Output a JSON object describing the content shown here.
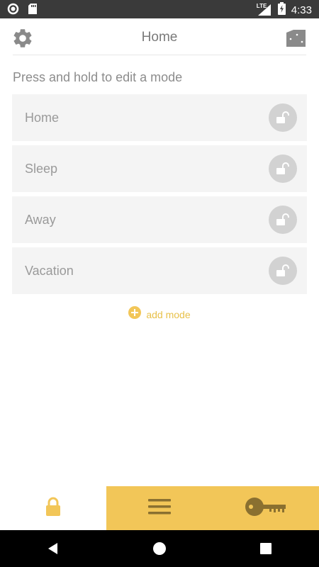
{
  "status_bar": {
    "time": "4:33",
    "network": "LTE",
    "icons": [
      "circle-notification-icon",
      "sd-card-icon",
      "signal-icon",
      "battery-charging-icon"
    ]
  },
  "header": {
    "title": "Home",
    "left_icon": "gear-icon",
    "right_icon": "door-icon"
  },
  "instruction": "Press and hold to edit a mode",
  "modes": [
    {
      "label": "Home",
      "icon": "unlocked-icon"
    },
    {
      "label": "Sleep",
      "icon": "unlocked-icon"
    },
    {
      "label": "Away",
      "icon": "unlocked-icon"
    },
    {
      "label": "Vacation",
      "icon": "unlocked-icon"
    }
  ],
  "add_mode": {
    "label": "add mode",
    "icon": "plus-circle-icon"
  },
  "tabs": [
    {
      "icon": "lock-icon",
      "active": true
    },
    {
      "icon": "menu-icon",
      "active": false
    },
    {
      "icon": "key-icon",
      "active": false
    }
  ],
  "colors": {
    "accent": "#F2C658",
    "add_mode_text": "#E8C14A",
    "mode_background": "#F4F4F4",
    "lock_circle": "#D2D2D2"
  },
  "nav": [
    "back-icon",
    "home-icon",
    "recents-icon"
  ]
}
